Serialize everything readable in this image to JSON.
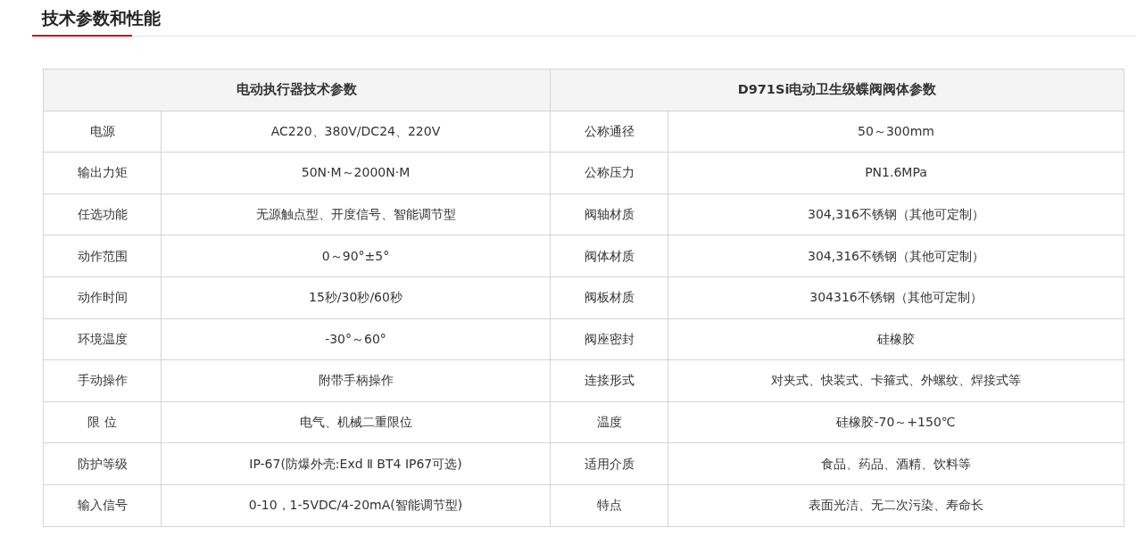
{
  "section_title": "技术参数和性能",
  "table": {
    "columns": [
      {
        "label": "电动执行器技术参数",
        "colspan": 2
      },
      {
        "label": "D971Si电动卫生级蝶阀阀体参数",
        "colspan": 2
      }
    ],
    "rows": [
      {
        "cells": [
          "电源",
          "AC220、380V/DC24、220V",
          "公称通径",
          "50～300mm"
        ]
      },
      {
        "cells": [
          "输出力矩",
          "50N·M～2000N·M",
          "公称压力",
          "PN1.6MPa"
        ]
      },
      {
        "cells": [
          "任选功能",
          "无源触点型、开度信号、智能调节型",
          "阀轴材质",
          "304,316不锈钢（其他可定制）"
        ]
      },
      {
        "cells": [
          "动作范围",
          "0～90°±5°",
          "阀体材质",
          "304,316不锈钢（其他可定制）"
        ]
      },
      {
        "cells": [
          "动作时间",
          "15秒/30秒/60秒",
          "阀板材质",
          "304316不锈钢（其他可定制）"
        ]
      },
      {
        "cells": [
          "环境温度",
          "-30°～60°",
          "阀座密封",
          "硅橡胶"
        ]
      },
      {
        "cells": [
          "手动操作",
          "附带手柄操作",
          "连接形式",
          "对夹式、快装式、卡箍式、外螺纹、焊接式等"
        ]
      },
      {
        "cells": [
          "限 位",
          "电气、机械二重限位",
          "温度",
          "硅橡胶-70～+150℃"
        ]
      },
      {
        "cells": [
          "防护等级",
          "IP-67(防爆外壳:Exd Ⅱ BT4 IP67可选)",
          "适用介质",
          "食品、药品、酒精、饮料等"
        ]
      },
      {
        "cells": [
          "输入信号",
          "0-10，1-5VDC/4-20mA(智能调节型)",
          "特点",
          "表面光洁、无二次污染、寿命长"
        ]
      }
    ]
  }
}
